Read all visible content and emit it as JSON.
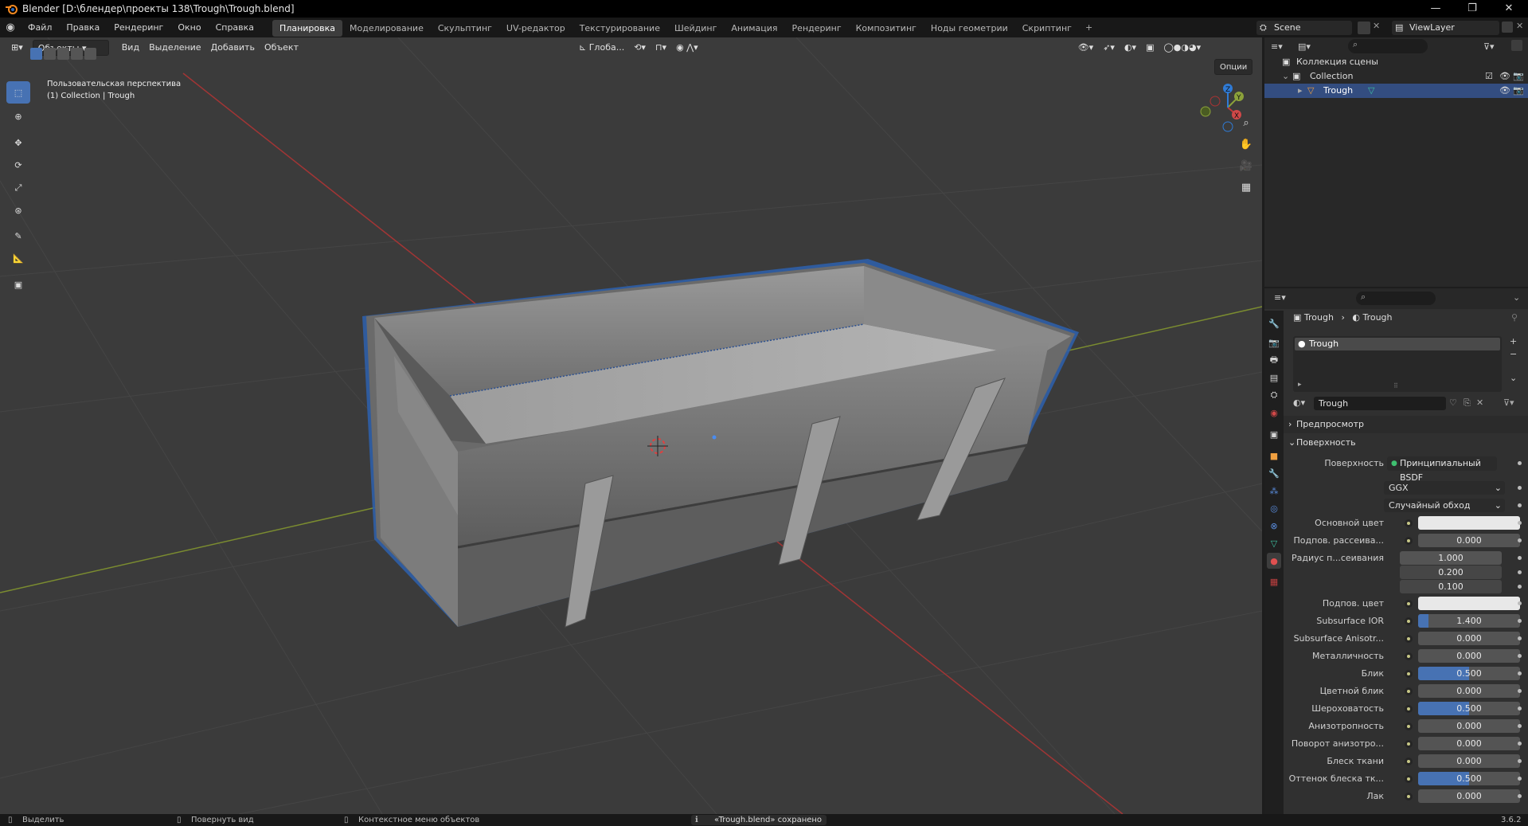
{
  "window": {
    "title": "Blender [D:\\блендер\\проекты 138\\Trough\\Trough.blend]",
    "minimize": "—",
    "maximize": "❐",
    "close": "✕"
  },
  "topbar": {
    "menus": [
      "Файл",
      "Правка",
      "Рендеринг",
      "Окно",
      "Справка"
    ],
    "workspaces": [
      "Планировка",
      "Моделирование",
      "Скульптинг",
      "UV-редактор",
      "Текстурирование",
      "Шейдинг",
      "Анимация",
      "Рендеринг",
      "Композитинг",
      "Ноды геометрии",
      "Скриптинг"
    ],
    "active_workspace": 0,
    "add_workspace": "+",
    "scene": "Scene",
    "view_layer": "ViewLayer"
  },
  "viewport": {
    "mode": "Объекты",
    "menus": [
      "Вид",
      "Выделение",
      "Добавить",
      "Объект"
    ],
    "orientation": "Глоба...",
    "options": "Опции",
    "overlay_title": "Пользовательская перспектива",
    "overlay_subtitle": "(1) Collection | Trough",
    "gizmo": {
      "x": "X",
      "y": "Y",
      "z": "Z"
    },
    "colors": {
      "bg": "#3b3b3b",
      "x_axis": "#c03a3a",
      "y_axis": "#8ca23a",
      "selection": "#4a8cf0"
    }
  },
  "outliner": {
    "rows": [
      {
        "label": "Коллекция сцены"
      },
      {
        "label": "Collection"
      },
      {
        "label": "Trough"
      }
    ]
  },
  "properties": {
    "breadcrumb": [
      "Trough",
      "Trough"
    ],
    "slot": "Trough",
    "material_name": "Trough",
    "sections": {
      "preview": "Предпросмотр",
      "surface": "Поверхность"
    },
    "surface_label": "Поверхность",
    "surface_value": "Принципиальный BSDF",
    "distribution": "GGX",
    "subsurface_method": "Случайный обход",
    "rows": [
      {
        "label": "Основной цвет",
        "value": "",
        "fill": 0,
        "swatch": true
      },
      {
        "label": "Подпов. рассеива...",
        "value": "0.000",
        "fill": 0
      },
      {
        "label": "Радиус п...сеивания",
        "value": "1.000",
        "fill": 0
      },
      {
        "label": "",
        "value": "0.200",
        "fill": 0
      },
      {
        "label": "",
        "value": "0.100",
        "fill": 0
      },
      {
        "label": "Подпов. цвет",
        "value": "",
        "fill": 0,
        "swatch": true
      },
      {
        "label": "Subsurface IOR",
        "value": "1.400",
        "fill": 0.1
      },
      {
        "label": "Subsurface Anisotr...",
        "value": "0.000",
        "fill": 0
      },
      {
        "label": "Металличность",
        "value": "0.000",
        "fill": 0
      },
      {
        "label": "Блик",
        "value": "0.500",
        "fill": 0.5
      },
      {
        "label": "Цветной блик",
        "value": "0.000",
        "fill": 0
      },
      {
        "label": "Шероховатость",
        "value": "0.500",
        "fill": 0.5
      },
      {
        "label": "Анизотропность",
        "value": "0.000",
        "fill": 0
      },
      {
        "label": "Поворот анизотро...",
        "value": "0.000",
        "fill": 0
      },
      {
        "label": "Блеск ткани",
        "value": "0.000",
        "fill": 0
      },
      {
        "label": "Оттенок блеска тк...",
        "value": "0.500",
        "fill": 0.5
      },
      {
        "label": "Лак",
        "value": "0.000",
        "fill": 0
      }
    ]
  },
  "statusbar": {
    "select": "Выделить",
    "rotate": "Повернуть вид",
    "context": "Контекстное меню объектов",
    "message": "«Trough.blend» сохранено",
    "version": "3.6.2"
  }
}
